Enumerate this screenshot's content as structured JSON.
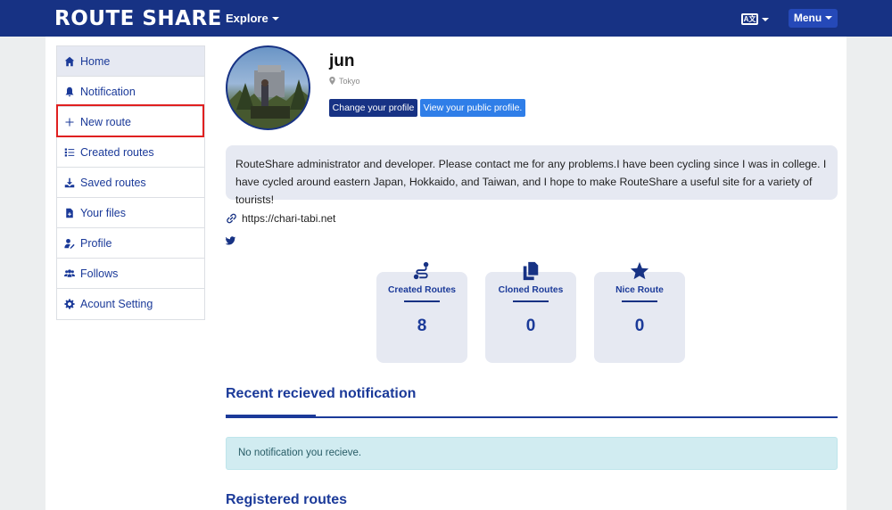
{
  "header": {
    "brand": "ROUTE SHARE",
    "explore_label": "Explore",
    "lang_icon_text": "A文",
    "menu_label": "Menu"
  },
  "sidebar": {
    "items": [
      {
        "label": "Home",
        "icon": "home-icon",
        "active": true
      },
      {
        "label": "Notification",
        "icon": "bell-icon"
      },
      {
        "label": "New route",
        "icon": "plus-icon",
        "highlighted": true
      },
      {
        "label": "Created routes",
        "icon": "list-icon"
      },
      {
        "label": "Saved routes",
        "icon": "download-icon"
      },
      {
        "label": "Your files",
        "icon": "file-icon"
      },
      {
        "label": "Profile",
        "icon": "user-edit-icon"
      },
      {
        "label": "Follows",
        "icon": "users-icon"
      },
      {
        "label": "Acount Setting",
        "icon": "gear-icon"
      }
    ]
  },
  "profile": {
    "username": "jun",
    "location": "Tokyo",
    "change_profile_label": "Change your profile",
    "public_profile_label": "View your public profile.",
    "bio": "RouteShare administrator and developer. Please contact me for any problems.I have been cycling since I was in college. I have cycled around eastern Japan, Hokkaido, and Taiwan, and I hope to make RouteShare a useful site for a variety of tourists!",
    "website": "https://chari-tabi.net"
  },
  "stats": [
    {
      "label": "Created Routes",
      "value": "8",
      "icon": "route-icon"
    },
    {
      "label": "Cloned Routes",
      "value": "0",
      "icon": "copy-icon"
    },
    {
      "label": "Nice Route",
      "value": "0",
      "icon": "star-icon"
    }
  ],
  "notifications": {
    "title": "Recent recieved notification",
    "empty_message": "No notification you recieve."
  },
  "registered_routes": {
    "title": "Registered routes"
  },
  "colors": {
    "navbar": "#173284",
    "accent": "#1b3a99",
    "highlight_border": "#e02020",
    "public_button": "#2f7ee8",
    "alert_bg": "#d1ecf1"
  }
}
